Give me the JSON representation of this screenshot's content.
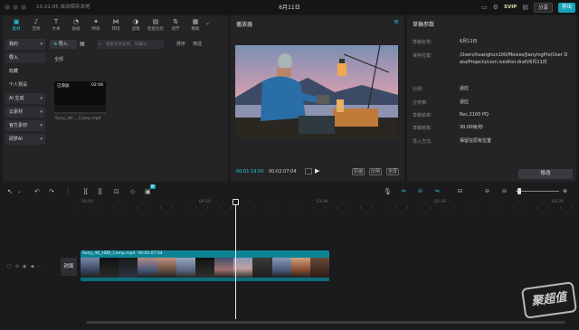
{
  "titlebar": {
    "save_status": "10:21:05 自动保存本地",
    "doc_title": "6月11日",
    "svip": "SVIP",
    "share": "分享",
    "export": "导出"
  },
  "tool_tabs": [
    {
      "icon": "media-icon",
      "label": "素材"
    },
    {
      "icon": "audio-icon",
      "label": "音频"
    },
    {
      "icon": "text-icon",
      "label": "文本"
    },
    {
      "icon": "sticker-icon",
      "label": "贴纸"
    },
    {
      "icon": "effects-icon",
      "label": "特效"
    },
    {
      "icon": "transition-icon",
      "label": "转场"
    },
    {
      "icon": "filter-icon",
      "label": "滤镜"
    },
    {
      "icon": "caption-icon",
      "label": "智能包装"
    },
    {
      "icon": "adjust-icon",
      "label": "调节"
    },
    {
      "icon": "template-icon",
      "label": "模板"
    }
  ],
  "left_nav": [
    {
      "label": "我的",
      "style": "box"
    },
    {
      "label": "导入",
      "style": "sel"
    },
    {
      "label": "收藏",
      "style": "plain"
    },
    {
      "label": "个人预设",
      "style": "plain"
    },
    {
      "label": "AI 生成",
      "style": "box"
    },
    {
      "label": "云素材",
      "style": "box"
    },
    {
      "label": "官方素材",
      "style": "box"
    },
    {
      "label": "即梦AI",
      "style": "box"
    }
  ],
  "media": {
    "import_label": "导入",
    "search_placeholder": "搜索文件名称、剪辑过…",
    "tools": [
      "排序",
      "筛选"
    ],
    "all_label": "全部",
    "clip": {
      "badge": "已添加",
      "duration": "02:08",
      "name": "Sony_4K..._Camp.mp4"
    }
  },
  "player": {
    "title": "播放器",
    "time_current": "00:01:19:00",
    "time_total": "00:02:07:04",
    "controls": [
      "原画",
      "比例",
      "全屏"
    ]
  },
  "draft": {
    "title": "草稿参数",
    "fields": [
      {
        "label": "草稿名称:",
        "value": "6月11日"
      },
      {
        "label": "保存位置:",
        "value": "/Users/huanghun100/Movies/JianyingPro/User Data/Projects/com.lveditor.draft/6月11日"
      },
      {
        "label": "比例:",
        "value": "适应"
      },
      {
        "label": "分辨率:",
        "value": "适应"
      },
      {
        "label": "草稿帧率:",
        "value": "Rec.2100 PQ"
      },
      {
        "label": "草稿帧率:",
        "value": "30.00帧/秒"
      },
      {
        "label": "导入方式:",
        "value": "保留在原有位置"
      }
    ],
    "modify_button": "修改"
  },
  "timeline": {
    "new_badge": "新",
    "ruler_ticks": [
      "00:00",
      "00:50",
      "01:40",
      "02:30",
      "03:20"
    ],
    "cover_label": "封面",
    "clip_label": "Sony_4K_HDR_Camp.mp4",
    "clip_duration": "00:02:07:04"
  },
  "watermark": "聚超值",
  "colors": {
    "accent": "#21c8d8",
    "clip": "#0d8494",
    "panel": "#242427",
    "bg": "#1b1b1d"
  }
}
